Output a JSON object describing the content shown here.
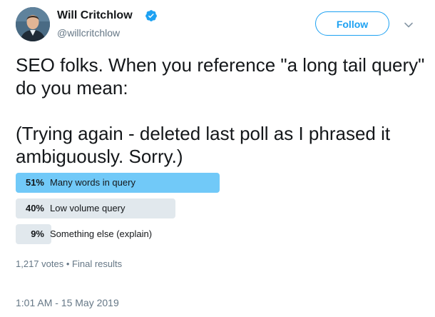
{
  "author": {
    "name": "Will Critchlow",
    "handle": "@willcritchlow",
    "avatar_icon": "profile-photo",
    "verified_icon": "verified-badge-icon"
  },
  "header": {
    "follow_label": "Follow",
    "menu_icon": "chevron-down-icon"
  },
  "tweet": {
    "text": "SEO folks. When you reference \"a long tail query\" do you mean:\n\n(Trying again - deleted last poll as I phrased it ambiguously. Sorry.)"
  },
  "poll": {
    "options": [
      {
        "percent_label": "51%",
        "percent": 51,
        "label": "Many words in query",
        "winner": true
      },
      {
        "percent_label": "40%",
        "percent": 40,
        "label": "Low volume query",
        "winner": false
      },
      {
        "percent_label": "9%",
        "percent": 9,
        "label": "Something else (explain)",
        "winner": false
      }
    ],
    "votes": "1,217 votes",
    "separator": "•",
    "status": "Final results"
  },
  "timestamp": "1:01 AM - 15 May 2019",
  "colors": {
    "accent": "#1da1f2",
    "winner_bar": "#71c9f8",
    "other_bar": "#e1e8ed",
    "muted_text": "#657786"
  }
}
